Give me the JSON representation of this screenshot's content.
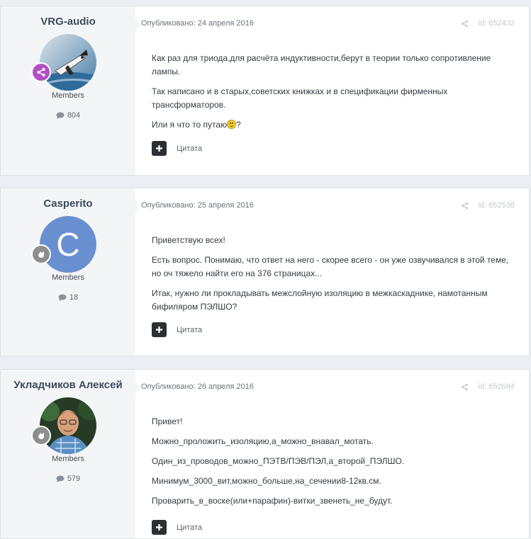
{
  "posts": [
    {
      "author": "VRG-audio",
      "group": "Members",
      "post_count": "804",
      "published": "Опубликовано: 24 апреля 2016",
      "post_id": "id: 652432",
      "quote_label": "Цитата",
      "paragraphs": [
        "Как раз для триода,для расчёта индуктивности,берут в теории только сопротивление лампы.",
        "Так написано и в старых,советских книжках и в спецификации фирменных трансформаторов."
      ],
      "last_line_before_smiley": "Или я что то путаю",
      "last_line_after_smiley": "?",
      "badge_color": "#b44ec6"
    },
    {
      "author": "Casperito",
      "group": "Members",
      "post_count": "18",
      "published": "Опубликовано: 25 апреля 2016",
      "post_id": "id: 652538",
      "quote_label": "Цитата",
      "avatar_letter": "C",
      "avatar_color": "#6a8fd1",
      "paragraphs": [
        "Приветствую всех!",
        "Есть вопрос. Понимаю, что ответ на него - скорее всего - он уже озвучивался в этой теме, но оч тяжело найти его на 376 страницах...",
        "Итак, нужно ли прокладывать межслойную изоляцию в межкаскаднике, намотанным бифиляром ПЭЛШО?"
      ],
      "badge_color": "#8e8e8e"
    },
    {
      "author": "Укладчиков Алексей",
      "group": "Members",
      "post_count": "579",
      "published": "Опубликовано: 26 апреля 2016",
      "post_id": "id: 652684",
      "quote_label": "Цитата",
      "paragraphs": [
        "Привет!",
        "Можно_проложить_изоляцию,а_можно_внавал_мотать.",
        "Один_из_проводов_можно_ПЭТВ/ПЭВ/ПЭЛ,а_второй_ПЭЛШО.",
        "Минимум_3000_вит,можно_больше,на_сечении8-12кв.см.",
        "Проварить_в_воске(или+парафин)-витки_звенеть_не_будут."
      ],
      "badge_color": "#8e8e8e"
    }
  ],
  "icons": {
    "comment": "comment-icon",
    "share": "share-icon",
    "plus": "plus-icon"
  }
}
